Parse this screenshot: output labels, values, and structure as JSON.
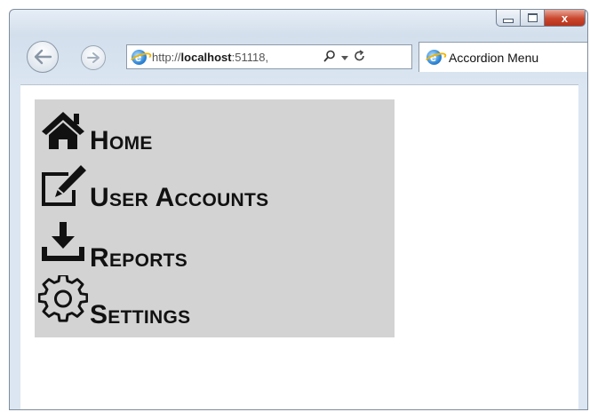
{
  "browser": {
    "url_prefix": "http://",
    "url_host": "localhost",
    "url_rest": ":51118,",
    "tab_title": "Accordion Menu",
    "close_glyph": "x"
  },
  "menu": {
    "items": [
      {
        "label": "Home",
        "icon": "home-icon"
      },
      {
        "label": "User Accounts",
        "icon": "edit-icon"
      },
      {
        "label": "Reports",
        "icon": "download-icon"
      },
      {
        "label": "Settings",
        "icon": "gear-icon"
      }
    ],
    "background": "#d3d3d3"
  }
}
